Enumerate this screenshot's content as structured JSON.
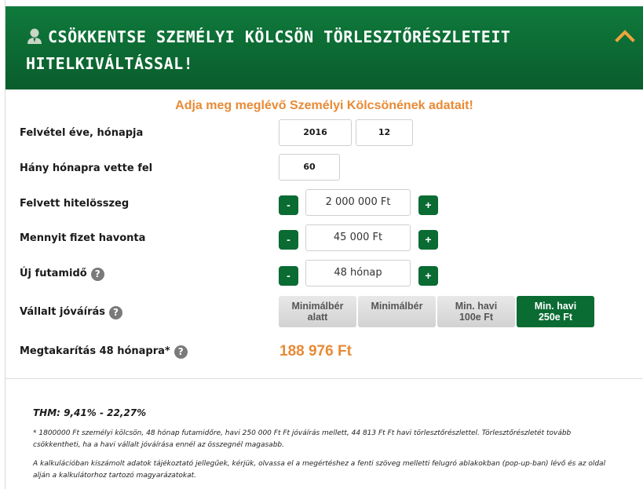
{
  "header": {
    "title": "CSÖKKENTSE SZEMÉLYI KÖLCSÖN TÖRLESZTŐRÉSZLETEIT HITELKIVÁLTÁSSAL!",
    "icon": "user-icon",
    "collapse_icon": "chevron-up-icon"
  },
  "form": {
    "subtitle": "Adja meg meglévő Személyi Kölcsönének adatait!",
    "start_date": {
      "label": "Felvétel éve, hónapja",
      "year": "2016",
      "month": "12"
    },
    "term": {
      "label": "Hány hónapra vette fel",
      "value": "60"
    },
    "amount": {
      "label": "Felvett hitelösszeg",
      "value": "2 000 000 Ft",
      "minus": "-",
      "plus": "+"
    },
    "monthly": {
      "label": "Mennyit fizet havonta",
      "value": "45 000 Ft",
      "minus": "-",
      "plus": "+"
    },
    "new_term": {
      "label": "Új futamidő",
      "value": "48 hónap",
      "minus": "-",
      "plus": "+",
      "help": "?"
    },
    "credit": {
      "label": "Vállalt jóváírás",
      "help": "?",
      "options": [
        {
          "line1": "Minimálbér",
          "line2": "alatt",
          "selected": false
        },
        {
          "line1": "Minimálbér",
          "line2": "",
          "selected": false
        },
        {
          "line1": "Min. havi",
          "line2": "100e Ft",
          "selected": false
        },
        {
          "line1": "Min. havi",
          "line2": "250e Ft",
          "selected": true
        }
      ]
    },
    "savings": {
      "label": "Megtakarítás 48 hónapra*",
      "help": "?",
      "value": "188 976 Ft"
    }
  },
  "footer": {
    "thm": "THM: 9,41% - 22,27%",
    "note1": "* 1800000 Ft személyi kölcsön, 48 hónap futamidőre, havi 250 000 Ft Ft jóváírás mellett, 44 813 Ft Ft havi törlesztőrészlettel. Törlesztőrészletét tovább csökkentheti, ha a havi vállalt jóváírása ennél az összegnél magasabb.",
    "note2": "A kalkulációban kiszámolt adatok tájékoztató jellegűek, kérjük, olvassa el a megértéshez a fenti szöveg melletti felugró ablakokban (pop-up-ban) lévő és az oldal alján a kalkulátorhoz tartozó magyarázatokat."
  },
  "colors": {
    "brand_green": "#0a6b33",
    "accent_orange": "#e88a35"
  }
}
